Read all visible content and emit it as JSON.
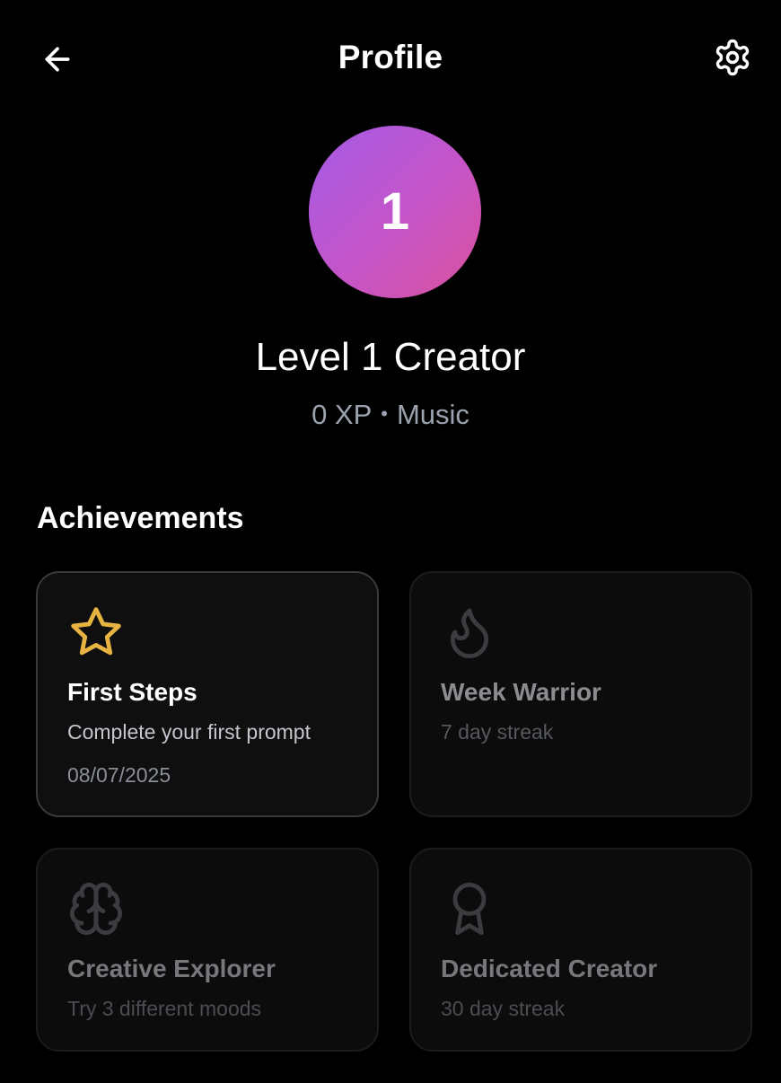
{
  "header": {
    "title": "Profile",
    "back_icon": "arrow-left-icon",
    "settings_icon": "gear-icon"
  },
  "profile": {
    "level_number": "1",
    "level_title": "Level 1 Creator",
    "xp": "0 XP",
    "separator": "•",
    "category": "Music",
    "avatar_gradient": [
      "#a45be6",
      "#d9529c"
    ]
  },
  "achievements": {
    "section_title": "Achievements",
    "items": [
      {
        "title": "First Steps",
        "description": "Complete your first prompt",
        "date": "08/07/2025",
        "icon": "star-icon",
        "unlocked": true,
        "icon_color": "#e8b441"
      },
      {
        "title": "Week Warrior",
        "description": "7 day streak",
        "icon": "flame-icon",
        "unlocked": false,
        "icon_color": "#3a3c40"
      },
      {
        "title": "Creative Explorer",
        "description": "Try 3 different moods",
        "icon": "brain-icon",
        "unlocked": false,
        "icon_color": "#3a3c40"
      },
      {
        "title": "Dedicated Creator",
        "description": "30 day streak",
        "icon": "award-icon",
        "unlocked": false,
        "icon_color": "#3a3c40"
      }
    ]
  }
}
